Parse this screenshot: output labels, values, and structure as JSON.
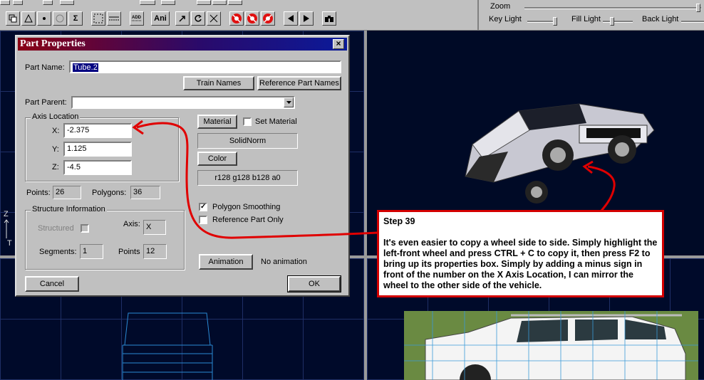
{
  "toolbar": {
    "ani_label": "Ani"
  },
  "light_panel": {
    "zoom_label": "Zoom",
    "key_light_label": "Key Light",
    "fill_light_label": "Fill Light",
    "back_light_label": "Back Light"
  },
  "viewport": {
    "axis_z_label": "Z",
    "axis_t_label": "T"
  },
  "dialog": {
    "title": "Part Properties",
    "part_name_label": "Part Name:",
    "part_name_value": "Tube.2",
    "train_names_button": "Train Names",
    "reference_part_names_button": "Reference Part Names",
    "part_parent_label": "Part Parent:",
    "part_parent_value": "",
    "axis_group_title": "Axis Location",
    "x_label": "X:",
    "x_value": "-2.375",
    "y_label": "Y:",
    "y_value": "1.125",
    "z_label": "Z:",
    "z_value": "-4.5",
    "material_button": "Material",
    "set_material_label": "Set Material",
    "material_value": "SolidNorm",
    "color_button": "Color",
    "color_value": "r128 g128 b128 a0",
    "points_label": "Points:",
    "points_value": "26",
    "polygons_label": "Polygons:",
    "polygons_value": "36",
    "polygon_smoothing_label": "Polygon Smoothing",
    "polygon_smoothing_checked": true,
    "reference_part_only_label": "Reference Part Only",
    "reference_part_only_checked": false,
    "structure_group_title": "Structure Information",
    "structured_label": "Structured",
    "axis_label": "Axis:",
    "axis_value": "X",
    "segments_label": "Segments:",
    "segments_value": "1",
    "struct_points_label": "Points",
    "struct_points_value": "12",
    "animation_button": "Animation",
    "animation_status": "No animation",
    "cancel_button": "Cancel",
    "ok_button": "OK"
  },
  "callout": {
    "step": "Step 39",
    "text": "It's even easier to copy a wheel side to side. Simply highlight the left-front wheel and press CTRL + C to copy it, then press F2 to bring up its properties box. Simply by adding a minus sign in front of the number on the X Axis Location, I can mirror the wheel to the other side of the vehicle."
  },
  "colors": {
    "annotation_red": "#e00000",
    "viewport_bg": "#000a2a",
    "dialog_face": "#c0c0c0"
  }
}
